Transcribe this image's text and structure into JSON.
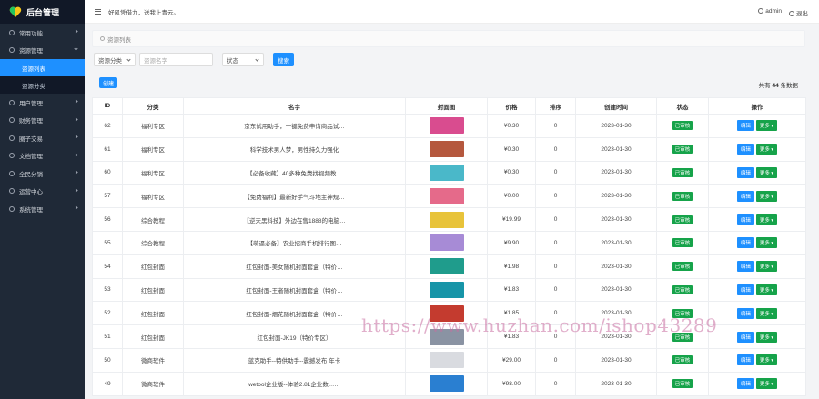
{
  "brand": {
    "title": "后台管理"
  },
  "sidebar": {
    "items": [
      {
        "label": "常用功能"
      },
      {
        "label": "资源管理"
      },
      {
        "label": "资源列表",
        "sub": true,
        "active": true
      },
      {
        "label": "资源分类",
        "sub": true
      },
      {
        "label": "用户管理"
      },
      {
        "label": "财务管理"
      },
      {
        "label": "圈子交易"
      },
      {
        "label": "文档管理"
      },
      {
        "label": "全民分销"
      },
      {
        "label": "运营中心"
      },
      {
        "label": "系统管理"
      }
    ]
  },
  "header": {
    "notice": "好风凭借力，送我上青云。",
    "user": "admin",
    "logout": "退出"
  },
  "page": {
    "section_title": "资源列表",
    "filter_category": "资源分类",
    "filter_name_placeholder": "资源名字",
    "filter_status": "状态",
    "search_label": "搜索",
    "create_label": "创建",
    "total_prefix": "共有",
    "total_count": "44",
    "total_suffix": "条数据"
  },
  "table": {
    "columns": [
      "ID",
      "分类",
      "名字",
      "封面图",
      "价格",
      "排序",
      "创建时间",
      "状态",
      "操作"
    ],
    "edit_label": "编辑",
    "more_label": "更多",
    "rows": [
      {
        "id": "62",
        "category": "福利专区",
        "name": "京东试用助手，一键免费申请商品试…",
        "price": "¥0.30",
        "sort": "0",
        "created": "2023-01-30",
        "status": "已审核",
        "thumb": "#d94c8f"
      },
      {
        "id": "61",
        "category": "福利专区",
        "name": "科学技术男人梦，男性持久力强化",
        "price": "¥0.30",
        "sort": "0",
        "created": "2023-01-30",
        "status": "已审核",
        "thumb": "#b5583e"
      },
      {
        "id": "60",
        "category": "福利专区",
        "name": "【必备收藏】40多种免费找视频教…",
        "price": "¥0.30",
        "sort": "0",
        "created": "2023-01-30",
        "status": "已审核",
        "thumb": "#4ab8c9"
      },
      {
        "id": "57",
        "category": "福利专区",
        "name": "【免费福利】最新好手气斗地主神规…",
        "price": "¥0.00",
        "sort": "0",
        "created": "2023-01-30",
        "status": "已审核",
        "thumb": "#e56a8a"
      },
      {
        "id": "56",
        "category": "综合教程",
        "name": "【逆天黑科技】外边在售1888的电脑…",
        "price": "¥19.99",
        "sort": "0",
        "created": "2023-01-30",
        "status": "已审核",
        "thumb": "#e8c33a"
      },
      {
        "id": "55",
        "category": "综合教程",
        "name": "【萌逼必备】农业招商手机排行图…",
        "price": "¥9.90",
        "sort": "0",
        "created": "2023-01-30",
        "status": "已审核",
        "thumb": "#a78bd6"
      },
      {
        "id": "54",
        "category": "红包封面",
        "name": "红包封面-美女随机封面套盒（特价…",
        "price": "¥1.98",
        "sort": "0",
        "created": "2023-01-30",
        "status": "已审核",
        "thumb": "#1f9c8c"
      },
      {
        "id": "53",
        "category": "红包封面",
        "name": "红包封面-王者随机封面套盒（特价…",
        "price": "¥1.83",
        "sort": "0",
        "created": "2023-01-30",
        "status": "已审核",
        "thumb": "#1795a8"
      },
      {
        "id": "52",
        "category": "红包封面",
        "name": "红包封面-烟花随机封面套盒（特价…",
        "price": "¥1.85",
        "sort": "0",
        "created": "2023-01-30",
        "status": "已审核",
        "thumb": "#c43b2f"
      },
      {
        "id": "51",
        "category": "红包封面",
        "name": "红包封面-JK19（特价专区）",
        "price": "¥1.83",
        "sort": "0",
        "created": "2023-01-30",
        "status": "已审核",
        "thumb": "#8a93a3"
      },
      {
        "id": "50",
        "category": "微商软件",
        "name": "蓝克助手--特供助手--震撼发布 年卡",
        "price": "¥29.00",
        "sort": "0",
        "created": "2023-01-30",
        "status": "已审核",
        "thumb": "#d9dbe0"
      },
      {
        "id": "49",
        "category": "微商软件",
        "name": "wetool企业版--体验2.81企业数……",
        "price": "¥98.00",
        "sort": "0",
        "created": "2023-01-30",
        "status": "已审核",
        "thumb": "#2a7fd1"
      }
    ]
  },
  "watermark": "https://www.huzhan.com/ishop43289"
}
